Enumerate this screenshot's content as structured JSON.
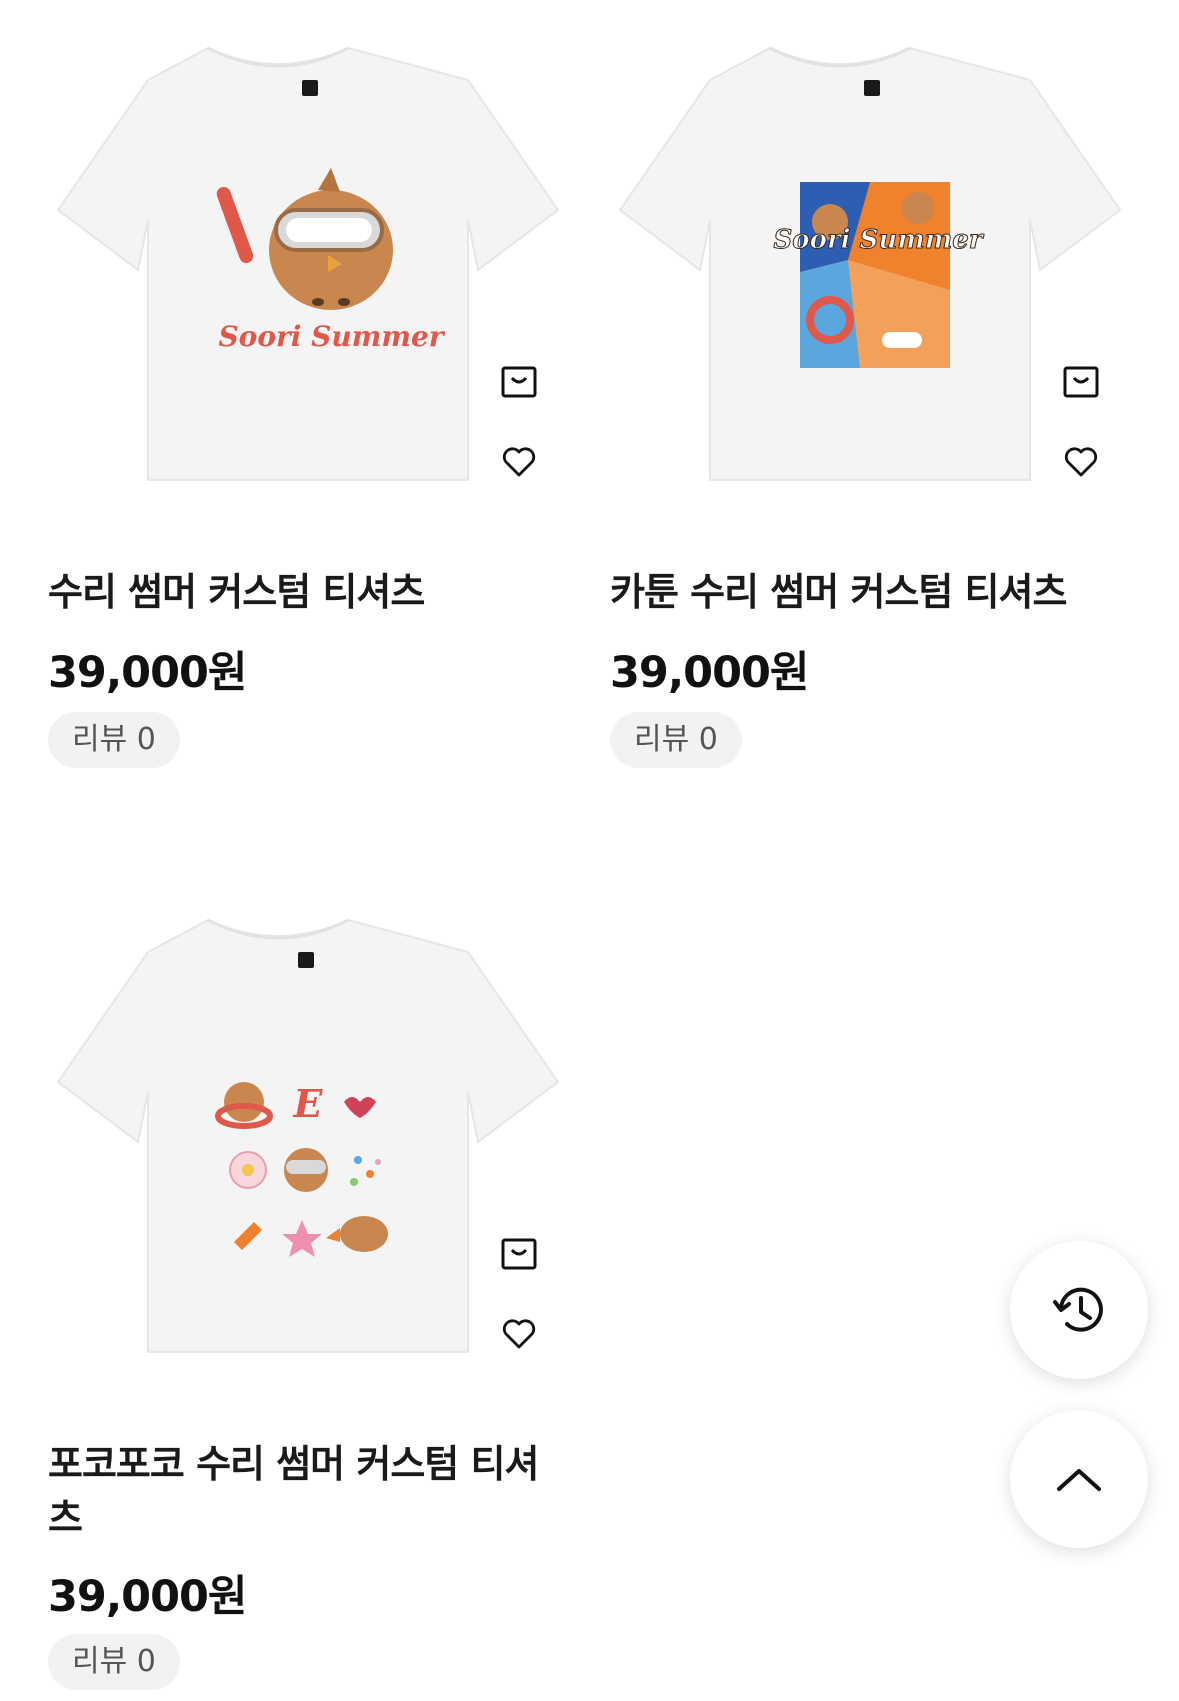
{
  "products": [
    {
      "name": "수리 썸머 커스텀 티셔츠",
      "price": "39,000원",
      "review": "리뷰 0",
      "print_text": "Soori Summer"
    },
    {
      "name": "카툰 수리 썸머 커스텀 티셔츠",
      "price": "39,000원",
      "review": "리뷰 0",
      "print_text": "Soori Summer"
    },
    {
      "name": "포코포코 수리 썸머 커스텀 티셔츠",
      "price": "39,000원",
      "review": "리뷰 0",
      "print_text": "E"
    }
  ],
  "icons": {
    "cart": "shopping-bag-icon",
    "wishlist": "heart-icon",
    "history": "history-icon",
    "scroll_top": "chevron-up-icon"
  },
  "colors": {
    "review_badge_bg": "#f2f2f2",
    "text_primary": "#111111",
    "text_secondary": "#555555"
  }
}
